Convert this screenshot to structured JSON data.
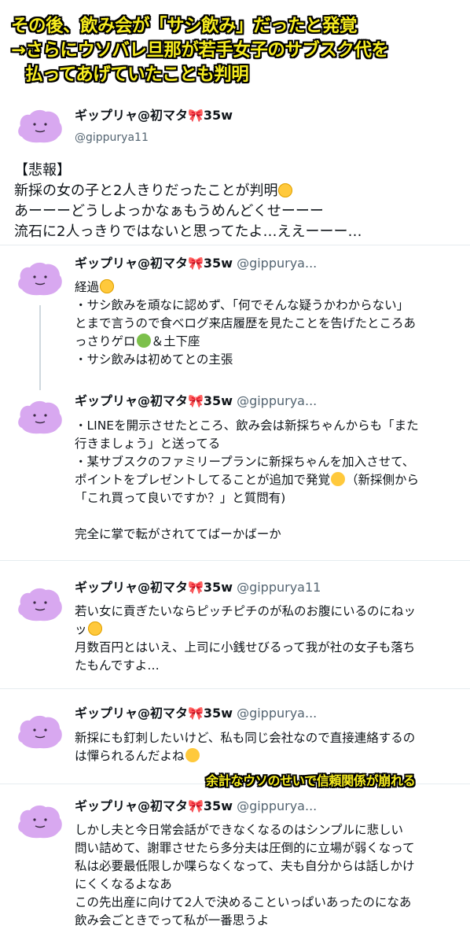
{
  "banner": {
    "line1": "その後、飲み会が「サシ飲み」だったと発覚",
    "line2": "→さらにウソバレ旦那が若手女子のサブスク代を",
    "line3": "払ってあげていたことも判明"
  },
  "colors": {
    "caption_fill": "#f6ec1f",
    "caption_stroke": "#000000",
    "avatar": "#d8a8f0",
    "thread_line": "#cfd9de"
  },
  "main_post": {
    "name": "ギップリャ@初マタ🎀35w",
    "handle": "@gippurya11",
    "text_l1": "【悲報】",
    "text_l2": "新採の女の子と2人きりだったことが判明",
    "text_l3": "あーーーどうしよっかなぁもうめんどくせーーー",
    "text_l4": "流石に2人っきりではないと思ってたよ…ええーーー…"
  },
  "reply1": {
    "name": "ギップリャ@初マタ🎀35w",
    "handle": "@gippurya...",
    "l1": "経過",
    "l2": "・サシ飲みを頑なに認めず、「何でそんな疑うかわからない」",
    "l3": "とまで言うので食べログ来店履歴を見たことを告げたところあ",
    "l4": "っさりゲロ",
    "l4b": "＆土下座",
    "l5": "・サシ飲みは初めてとの主張"
  },
  "reply2": {
    "name": "ギップリャ@初マタ🎀35w",
    "handle": "@gippurya...",
    "l1": "・LINEを開示させたところ、飲み会は新採ちゃんからも「また",
    "l2": "行きましょう」と送ってる",
    "l3": "・某サブスクのファミリープランに新採ちゃんを加入させて、",
    "l4": "ポイントをプレゼントしてることが追加で発覚",
    "l4b": "（新採側から",
    "l5": "「これ買って良いですか？」と質問有)",
    "l6": "完全に掌で転がされててばーかばーか"
  },
  "reply3": {
    "name": "ギップリャ@初マタ🎀35w",
    "handle": "@gippurya11",
    "l1": "若い女に貢ぎたいならピッチピチのが私のお腹にいるのにねッ",
    "l2": "ッ",
    "l3": "月数百円とはいえ、上司に小銭せびるって我が社の女子も落ち",
    "l4": "たもんですよ…"
  },
  "reply4": {
    "name": "ギップリャ@初マタ🎀35w",
    "handle": "@gippurya...",
    "l1": "新採にも釘刺したいけど、私も同じ会社なので直接連絡するの",
    "l2": "は憚られるんだよね"
  },
  "overlay_caption": "余計なウソのせいで信頼関係が崩れる",
  "reply5": {
    "name": "ギップリャ@初マタ🎀35w",
    "handle": "@gippurya...",
    "l1": "しかし夫と今日常会話ができなくなるのはシンプルに悲しい",
    "l2": "問い詰めて、謝罪させたら多分夫は圧倒的に立場が弱くなって",
    "l3": "私は必要最低限しか喋らなくなって、夫も自分からは話しかけ",
    "l4": "にくくなるよなあ",
    "l5": "この先出産に向けて2人で決めることいっぱいあったのになあ",
    "l6": "飲み会ごときでって私が一番思うよ"
  }
}
